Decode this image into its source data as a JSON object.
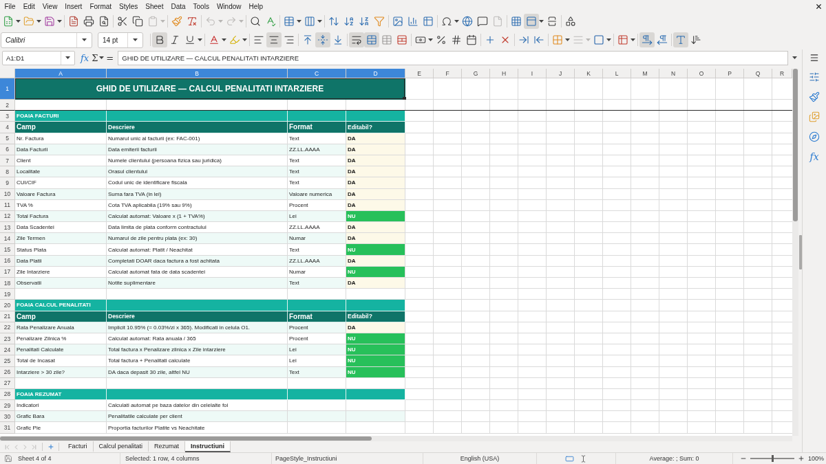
{
  "menu": [
    "File",
    "Edit",
    "View",
    "Insert",
    "Format",
    "Styles",
    "Sheet",
    "Data",
    "Tools",
    "Window",
    "Help"
  ],
  "standard_toolbar": {
    "paste_available": false,
    "undo_available": false,
    "redo_available": false,
    "header_footer_available": false,
    "freeze_rows_columns": true
  },
  "formatting_toolbar": {
    "font_name": "Calibri",
    "font_size": "14 pt",
    "bold": true,
    "italic": false,
    "underline": false,
    "align_left": false,
    "align_center": true,
    "align_right": false,
    "align_top": false,
    "align_middle": true,
    "align_bottom": false,
    "wrap_text": true,
    "merge_and_center": true,
    "line_style_available": false,
    "left_to_right": true,
    "right_to_left": false,
    "text_horizontal": true,
    "text_vertical": false
  },
  "formula_bar": {
    "name_box": "A1:D1",
    "function_wizard": "fx",
    "sum_symbol": "Σ",
    "formula_symbol": "=",
    "content": "GHID DE UTILIZARE — CALCUL PENALITATI INTARZIERE"
  },
  "sheet": {
    "columns": [
      {
        "label": "A",
        "selected": true
      },
      {
        "label": "B",
        "selected": true
      },
      {
        "label": "C",
        "selected": true
      },
      {
        "label": "D",
        "selected": true
      },
      {
        "label": "E",
        "selected": false
      },
      {
        "label": "F",
        "selected": false
      },
      {
        "label": "G",
        "selected": false
      },
      {
        "label": "H",
        "selected": false
      },
      {
        "label": "I",
        "selected": false
      },
      {
        "label": "J",
        "selected": false
      },
      {
        "label": "K",
        "selected": false
      },
      {
        "label": "L",
        "selected": false
      },
      {
        "label": "M",
        "selected": false
      },
      {
        "label": "N",
        "selected": false
      },
      {
        "label": "O",
        "selected": false
      },
      {
        "label": "P",
        "selected": false
      },
      {
        "label": "Q",
        "selected": false
      },
      {
        "label": "R",
        "selected": false
      }
    ],
    "rows": [
      {
        "number": "1",
        "kind": "title",
        "selected": true,
        "title": "GHID DE UTILIZARE — CALCUL PENALITATI INTARZIERE"
      },
      {
        "number": "2",
        "kind": "blank",
        "selected": false
      },
      {
        "number": "3",
        "kind": "section",
        "selected": false,
        "text": "FOAIA FACTURI"
      },
      {
        "number": "4",
        "kind": "header",
        "selected": false,
        "cells": [
          "Camp",
          "Descriere",
          "Format",
          "Editabil?"
        ]
      },
      {
        "number": "5",
        "kind": "field",
        "selected": false,
        "field": "Nr. Factura",
        "description": "Numarul unic al facturii (ex: FAC-001)",
        "format": "Text",
        "editable": "DA",
        "calculated": false
      },
      {
        "number": "6",
        "kind": "field",
        "selected": false,
        "field": "Data Facturii",
        "description": "Data emiterii facturii",
        "format": "ZZ.LL.AAAA",
        "editable": "DA",
        "calculated": false
      },
      {
        "number": "7",
        "kind": "field",
        "selected": false,
        "field": "Client",
        "description": "Numele clientului (persoana fizica sau juridica)",
        "format": "Text",
        "editable": "DA",
        "calculated": false
      },
      {
        "number": "8",
        "kind": "field",
        "selected": false,
        "field": "Localitate",
        "description": "Orasul clientului",
        "format": "Text",
        "editable": "DA",
        "calculated": false
      },
      {
        "number": "9",
        "kind": "field",
        "selected": false,
        "field": "CUI/CIF",
        "description": "Codul unic de identificare fiscala",
        "format": "Text",
        "editable": "DA",
        "calculated": false
      },
      {
        "number": "10",
        "kind": "field",
        "selected": false,
        "field": "Valoare Factura",
        "description": "Suma fara TVA (in lei)",
        "format": "Valoare numerica",
        "editable": "DA",
        "calculated": false
      },
      {
        "number": "11",
        "kind": "field",
        "selected": false,
        "field": "TVA %",
        "description": "Cota TVA aplicabila (19% sau 9%)",
        "format": "Procent",
        "editable": "DA",
        "calculated": false
      },
      {
        "number": "12",
        "kind": "field",
        "selected": false,
        "field": "Total Factura",
        "description": "Calculat automat: Valoare x (1 + TVA%)",
        "format": "Lei",
        "editable": "NU",
        "calculated": true
      },
      {
        "number": "13",
        "kind": "field",
        "selected": false,
        "field": "Data Scadentei",
        "description": "Data limita de plata conform contractului",
        "format": "ZZ.LL.AAAA",
        "editable": "DA",
        "calculated": false
      },
      {
        "number": "14",
        "kind": "field",
        "selected": false,
        "field": "Zile Termen",
        "description": "Numarul de zile pentru plata (ex: 30)",
        "format": "Numar",
        "editable": "DA",
        "calculated": false
      },
      {
        "number": "15",
        "kind": "field",
        "selected": false,
        "field": "Status Plata",
        "description": "Calculat automat: Platit / Neachitat",
        "format": "Text",
        "editable": "NU",
        "calculated": true
      },
      {
        "number": "16",
        "kind": "field",
        "selected": false,
        "field": "Data Platii",
        "description": "Completati DOAR daca factura a fost achitata",
        "format": "ZZ.LL.AAAA",
        "editable": "DA",
        "calculated": false
      },
      {
        "number": "17",
        "kind": "field",
        "selected": false,
        "field": "Zile Intarziere",
        "description": "Calculat automat fata de data scadentei",
        "format": "Numar",
        "editable": "NU",
        "calculated": true
      },
      {
        "number": "18",
        "kind": "field",
        "selected": false,
        "field": "Observatii",
        "description": "Notite suplimentare",
        "format": "Text",
        "editable": "DA",
        "calculated": false
      },
      {
        "number": "19",
        "kind": "blank",
        "selected": false
      },
      {
        "number": "20",
        "kind": "section",
        "selected": false,
        "text": "FOAIA CALCUL PENALITATI"
      },
      {
        "number": "21",
        "kind": "header",
        "selected": false,
        "cells": [
          "Camp",
          "Descriere",
          "Format",
          "Editabil?"
        ]
      },
      {
        "number": "22",
        "kind": "field",
        "selected": false,
        "field": "Rata Penalizare Anuala",
        "description": "Implicit 10.95% (= 0.03%/zi x 365). Modificati in celula O1.",
        "format": "Procent",
        "editable": "DA",
        "calculated": false
      },
      {
        "number": "23",
        "kind": "field",
        "selected": false,
        "field": "Penalizare Zilnica %",
        "description": "Calculat automat: Rata anuala / 365",
        "format": "Procent",
        "editable": "NU",
        "calculated": true
      },
      {
        "number": "24",
        "kind": "field",
        "selected": false,
        "field": "Penalitati Calculate",
        "description": "Total factura x Penalizare zilnica x Zile intarziere",
        "format": "Lei",
        "editable": "NU",
        "calculated": true
      },
      {
        "number": "25",
        "kind": "field",
        "selected": false,
        "field": "Total de Incasat",
        "description": "Total factura + Penalitati calculate",
        "format": "Lei",
        "editable": "NU",
        "calculated": true
      },
      {
        "number": "26",
        "kind": "field",
        "selected": false,
        "field": "Intarziere > 30 zile?",
        "description": "DA daca depasit 30 zile, altfel NU",
        "format": "Text",
        "editable": "NU",
        "calculated": true
      },
      {
        "number": "27",
        "kind": "blank",
        "selected": false
      },
      {
        "number": "28",
        "kind": "section",
        "selected": false,
        "text": "FOAIA REZUMAT"
      },
      {
        "number": "29",
        "kind": "note",
        "selected": false,
        "field": "Indicatori",
        "description": "Calculati automat pe baza datelor din celelalte foi"
      },
      {
        "number": "30",
        "kind": "note",
        "selected": false,
        "field": "Grafic Bara",
        "description": "Penalitatile calculate per client"
      },
      {
        "number": "31",
        "kind": "note",
        "selected": false,
        "field": "Grafic Pie",
        "description": "Proportia facturilor Platite vs Neachitate"
      }
    ]
  },
  "sheet_tabs": [
    {
      "label": "Facturi",
      "selected": false
    },
    {
      "label": "Calcul penalitati",
      "selected": false
    },
    {
      "label": "Rezumat",
      "selected": false
    },
    {
      "label": "Instructiuni",
      "selected": true
    }
  ],
  "sidebar": {
    "functions_label": "fx"
  },
  "status_bar": {
    "sheet_position": "Sheet 4 of 4",
    "selection": "Selected: 1 row, 4 columns",
    "page_style": "PageStyle_Instructiuni",
    "language": "English (USA)",
    "summary": "Average: ; Sum: 0",
    "zoom": "100%",
    "zoom_slider": {
      "level": 0.5
    }
  }
}
